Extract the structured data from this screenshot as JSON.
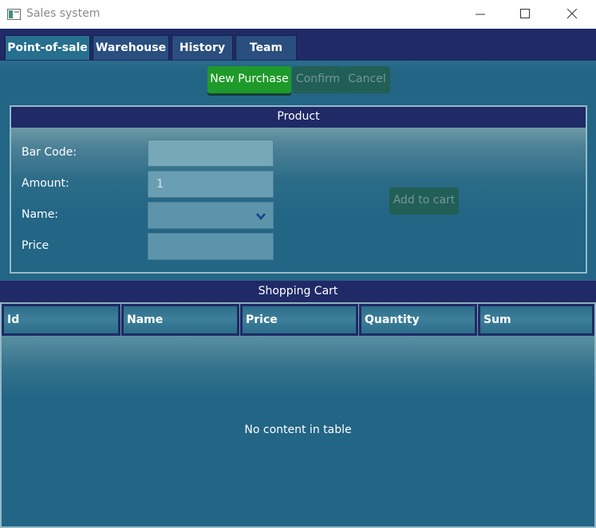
{
  "window": {
    "title": "Sales system"
  },
  "tabs": [
    {
      "label": "Point-of-sale"
    },
    {
      "label": "Warehouse"
    },
    {
      "label": "History"
    },
    {
      "label": "Team"
    }
  ],
  "actions": {
    "new_purchase": "New Purchase",
    "confirm": "Confirm",
    "cancel": "Cancel"
  },
  "product": {
    "header": "Product",
    "barcode_label": "Bar Code:",
    "barcode_value": "",
    "amount_label": "Amount:",
    "amount_value": "1",
    "name_label": "Name:",
    "name_value": "",
    "price_label": "Price",
    "price_value": "",
    "add_to_cart": "Add to cart"
  },
  "cart": {
    "header": "Shopping Cart",
    "columns": [
      "Id",
      "Name",
      "Price",
      "Quantity",
      "Sum"
    ],
    "empty_message": "No content in table"
  },
  "colors": {
    "accent_green": "#1e9a2a",
    "navy": "#1f2a66",
    "teal": "#226585"
  }
}
